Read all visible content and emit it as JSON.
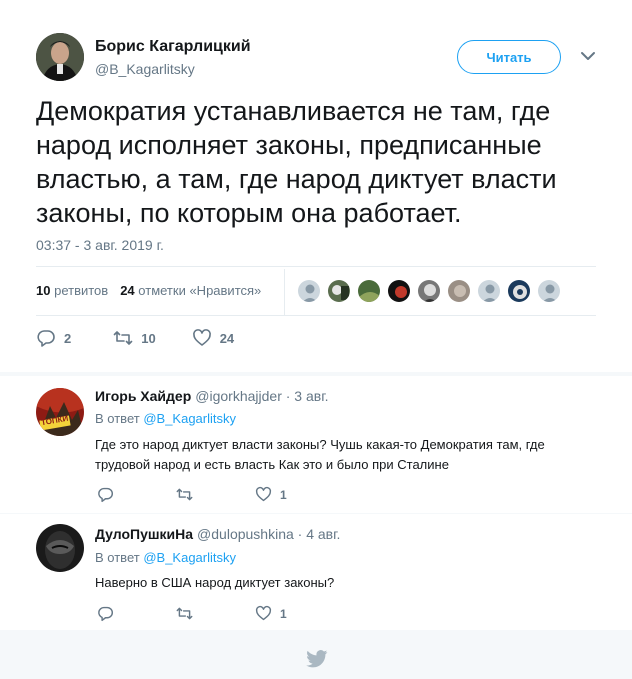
{
  "tweet": {
    "author_name": "Борис Кагарлицкий",
    "author_handle": "@B_Kagarlitsky",
    "follow_label": "Читать",
    "text": "Демократия устанавливается не там, где народ исполняет законы, предписанные властью, а там, где народ диктует власти законы, по которым она работает.",
    "timestamp": "03:37 - 3 авг. 2019 г.",
    "retweets_count": "10",
    "retweets_label": "ретвитов",
    "likes_count": "24",
    "likes_label": "отметки «Нравится»",
    "reply_count": "2",
    "retweet_action_count": "10",
    "like_action_count": "24"
  },
  "replies": [
    {
      "name": "Игорь Хайдер",
      "handle": "@igorkhajjder",
      "date": "· 3 авг.",
      "in_reply_prefix": "В ответ",
      "in_reply_to": "@B_Kagarlitsky",
      "text": "Где это народ диктует власти законы? Чушь какая-то Демократия там, где трудовой народ и есть власть Как это и было при Сталине",
      "likes": "1",
      "avatar_label": "ТОПКИ"
    },
    {
      "name": "ДулоПушкиНа",
      "handle": "@dulopushkina",
      "date": "· 4 авг.",
      "in_reply_prefix": "В ответ",
      "in_reply_to": "@B_Kagarlitsky",
      "text": "Наверно в США народ диктует законы?",
      "likes": "1"
    }
  ],
  "colors": {
    "accent": "#1da1f2",
    "secondary_text": "#657786",
    "primary_text": "#14171a",
    "divider": "#e6ecf0"
  },
  "icons": [
    "chevron-down-icon",
    "reply-icon",
    "retweet-icon",
    "heart-icon",
    "twitter-bird-icon"
  ]
}
